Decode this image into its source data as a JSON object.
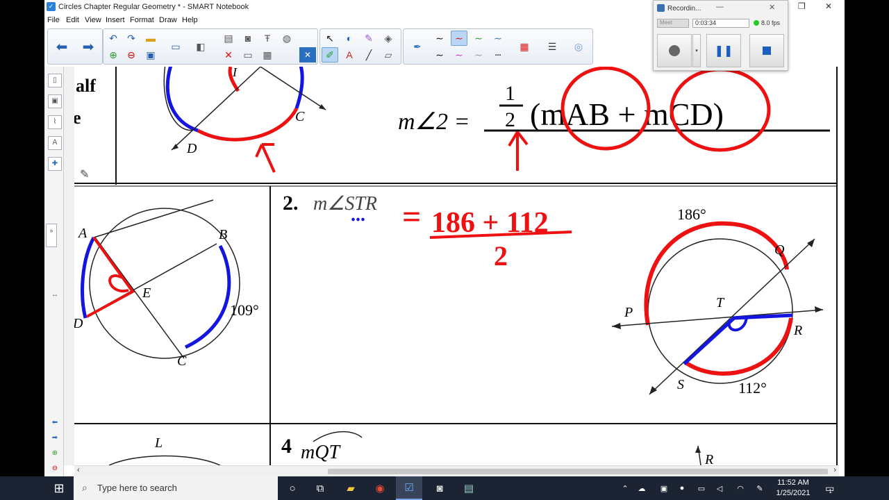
{
  "window": {
    "title": "Circles Chapter Regular Geometry * - SMART Notebook",
    "app_icon": "smart-notebook-icon",
    "minimize": "—",
    "restore": "❐",
    "close": "✕"
  },
  "menu": [
    "File",
    "Edit",
    "View",
    "Insert",
    "Format",
    "Draw",
    "Help"
  ],
  "recorder": {
    "title": "Recordin...",
    "mode": "Meet",
    "time": "0:03:34",
    "fps": "8.0 fps",
    "status_color": "#22cc22"
  },
  "worksheet": {
    "top": {
      "partial_label_1": "alf",
      "partial_label_2": "e",
      "point_i": "I",
      "point_c": "C",
      "point_d": "D",
      "eq_left": "m∠2 =",
      "eq_num": "1",
      "eq_den": "2",
      "eq_body": "(mAB + mCD)"
    },
    "problem_1": {
      "labels": [
        "A",
        "B",
        "E",
        "D",
        "C"
      ],
      "arc_value": "109°"
    },
    "problem_2": {
      "number": "2.",
      "prompt": "m∠STR",
      "ellipsis": "...",
      "eq_sign": "=",
      "numerator": "186 + 112",
      "denominator": "2",
      "arc_top": "186°",
      "arc_bottom": "112°",
      "labels": {
        "q": "Q",
        "p": "P",
        "t": "T",
        "r": "R",
        "s": "S"
      }
    },
    "problem_3": {
      "label_l": "L"
    },
    "problem_4": {
      "number": "4",
      "prompt": "mQT",
      "label_r": "R"
    }
  },
  "colors": {
    "ink_red": "#ee1111",
    "ink_blue": "#1515e0",
    "toolbar_blue": "#2560b0"
  },
  "taskbar": {
    "search_placeholder": "Type here to search",
    "time": "11:52 AM",
    "date": "1/25/2021",
    "notification_count": "1"
  }
}
